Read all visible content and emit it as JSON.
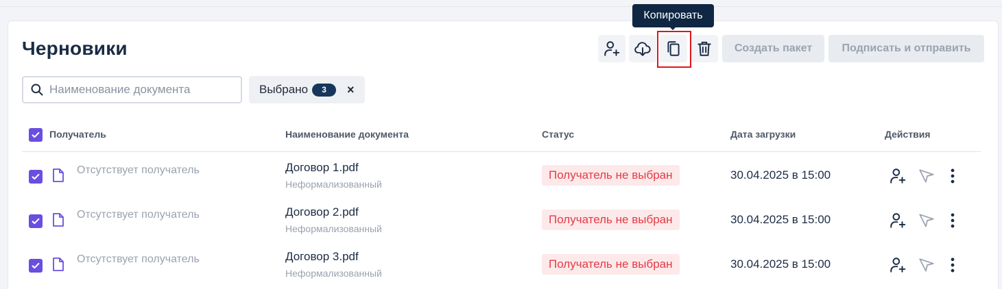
{
  "page": {
    "title": "Черновики"
  },
  "toolbar": {
    "tooltip": "Копировать",
    "create_package_label": "Создать пакет",
    "sign_send_label": "Подписать и отправить"
  },
  "search": {
    "placeholder": "Наименование документа",
    "value": ""
  },
  "selection_chip": {
    "label": "Выбрано",
    "count": "3",
    "close": "×"
  },
  "table": {
    "headers": {
      "recipient": "Получатель",
      "document": "Наименование документа",
      "status": "Статус",
      "date": "Дата загрузки",
      "actions": "Действия"
    },
    "rows": [
      {
        "recipient": "Отсутствует получатель",
        "doc_name": "Договор 1.pdf",
        "doc_type": "Неформализованный",
        "status": "Получатель не выбран",
        "date": "30.04.2025 в 15:00"
      },
      {
        "recipient": "Отсутствует получатель",
        "doc_name": "Договор 2.pdf",
        "doc_type": "Неформализованный",
        "status": "Получатель не выбран",
        "date": "30.04.2025 в 15:00"
      },
      {
        "recipient": "Отсутствует получатель",
        "doc_name": "Договор 3.pdf",
        "doc_type": "Неформализованный",
        "status": "Получатель не выбран",
        "date": "30.04.2025 в 15:00"
      }
    ]
  },
  "colors": {
    "accent": "#6a4ee0",
    "navy": "#17365c",
    "status_bg": "#fde9ea",
    "status_text": "#e23c45",
    "highlight": "#e0141e"
  }
}
